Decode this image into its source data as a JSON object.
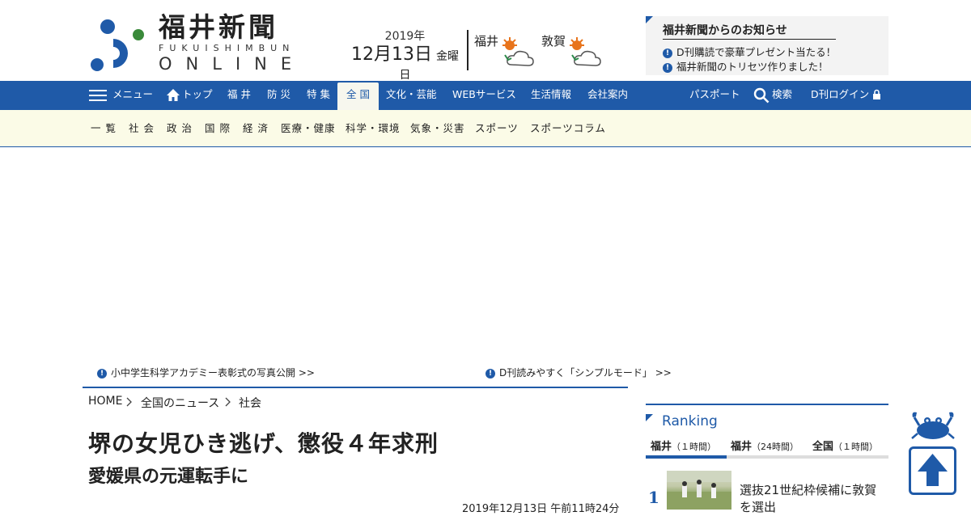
{
  "header": {
    "logo_jp": "福井新聞",
    "logo_roman": "FUKUISHIMBUN",
    "logo_online": "ONLINE",
    "date_year": "2019年",
    "date_day": "12月13日",
    "date_weekday": "金曜日",
    "weather": [
      {
        "city": "福井",
        "icon": "sun-cloud-icon"
      },
      {
        "city": "敦賀",
        "icon": "sun-cloud-icon"
      }
    ],
    "notice": {
      "title": "福井新聞からのお知らせ",
      "items": [
        "D刊購読で豪華プレゼント当たる！",
        "福井新聞のトリセツ作りました！"
      ]
    }
  },
  "nav": {
    "menu": "メニュー",
    "top": "トップ",
    "items": [
      "福 井",
      "防 災",
      "特 集",
      "全 国",
      "文化・芸能",
      "WEBサービス",
      "生活情報",
      "会社案内"
    ],
    "active": "全 国",
    "passport": "パスポート",
    "search": "検索",
    "login": "D刊ログイン"
  },
  "subnav": {
    "items": [
      "一 覧",
      "社 会",
      "政 治",
      "国 際",
      "経 済",
      "医療・健康",
      "科学・環境",
      "気象・災害",
      "スポーツ",
      "スポーツコラム"
    ]
  },
  "promo": {
    "left": "小中学生科学アカデミー表彰式の写真公開 >>",
    "right": "D刊読みやすく「シンプルモード」 >>"
  },
  "breadcrumb": [
    "HOME",
    "全国のニュース",
    "社会"
  ],
  "article": {
    "headline": "堺の女児ひき逃げ、懲役４年求刑",
    "subhead": "愛媛県の元運転手に",
    "date": "2019年12月13日 午前11時24分"
  },
  "ranking": {
    "title": "Ranking",
    "tabs": [
      {
        "name": "福井",
        "period": "（１時間）"
      },
      {
        "name": "福井",
        "period": "（24時間）"
      },
      {
        "name": "全国",
        "period": "（１時間）"
      }
    ],
    "items": [
      {
        "rank": "1",
        "text": "選抜21世紀枠候補に敦賀を選出"
      }
    ]
  },
  "colors": {
    "brand_blue": "#1f5aa8",
    "subnav_bg": "#fbfbe7",
    "logo_green": "#3a8a3a"
  }
}
